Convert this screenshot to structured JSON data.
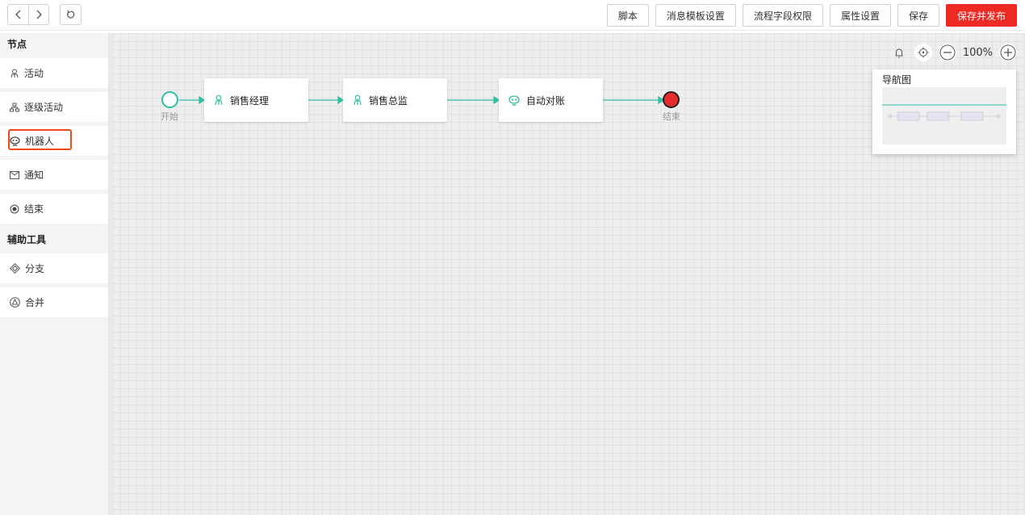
{
  "toolbar": {
    "back_icon": "chevron-left-icon",
    "forward_icon": "chevron-right-icon",
    "refresh_icon": "refresh-icon",
    "buttons": {
      "script": "脚本",
      "msg_template": "消息模板设置",
      "field_permission": "流程字段权限",
      "properties": "属性设置",
      "save": "保存",
      "save_publish": "保存并发布"
    },
    "accent_color": "#ee2a26"
  },
  "sidebar": {
    "nodes_title": "节点",
    "items": [
      {
        "label": "活动",
        "icon": "person-icon"
      },
      {
        "label": "逐级活动",
        "icon": "hierarchy-icon"
      },
      {
        "label": "机器人",
        "icon": "robot-icon"
      },
      {
        "label": "通知",
        "icon": "mail-icon"
      },
      {
        "label": "结束",
        "icon": "end-dot-icon"
      }
    ],
    "tools_title": "辅助工具",
    "tools": [
      {
        "label": "分支",
        "icon": "diamond-icon"
      },
      {
        "label": "合并",
        "icon": "merge-icon"
      }
    ]
  },
  "flow": {
    "start_label": "开始",
    "end_label": "结束",
    "nodes": [
      {
        "label": "销售经理",
        "icon": "person-icon"
      },
      {
        "label": "销售总监",
        "icon": "person-icon"
      },
      {
        "label": "自动对账",
        "icon": "robot-icon"
      }
    ],
    "line_color": "#2fbfa0"
  },
  "zoom": {
    "value": "100%"
  },
  "minimap": {
    "title": "导航图"
  }
}
